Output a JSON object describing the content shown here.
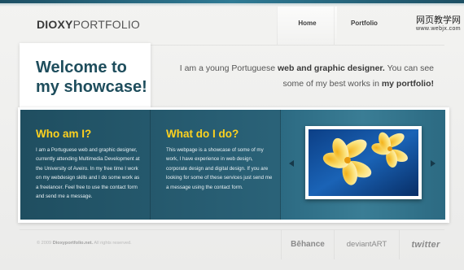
{
  "header": {
    "logo_bold": "DIOXY",
    "logo_rest": "PORTFOLIO",
    "nav": [
      "Home",
      "Portfolio"
    ]
  },
  "watermark": {
    "cn": "网页教学网",
    "url": "www.webjx.com"
  },
  "hero": {
    "title_line1": "Welcome to",
    "title_line2": "my showcase!",
    "intro_1": "I am a young Portuguese ",
    "intro_2": "web and graphic designer.",
    "intro_3": " You can see some of my best works in ",
    "intro_4": "my portfolio!"
  },
  "panel": {
    "col1": {
      "title": "Who am I?",
      "text": "I am a Portuguese web and graphic designer, currently attending Multimedia Development at the University of Aveiro. In my free time I work on my webdesign skills and I do some work as a freelancer. Feel free to use the contact form and send me a message."
    },
    "col2": {
      "title": "What do I do?",
      "text": "This webpage is a showcase of some of my work, I have experience in web design, corporate design and digital design. If you are looking for some of these services just send me a message using the contact form."
    }
  },
  "footer": {
    "copyright_pre": "© 2009 ",
    "copyright_site": "Dioxyportfolio.net.",
    "copyright_post": " All rights reserved.",
    "social": [
      "Bēhance",
      "deviantART",
      "twitter"
    ]
  },
  "colors": {
    "accent_yellow": "#ffd21e",
    "panel_blue": "#2a6278",
    "title_blue": "#1e4d5c",
    "top_bar": "#1d4f63"
  },
  "icons": [
    "arrow-left-icon",
    "arrow-right-icon"
  ]
}
